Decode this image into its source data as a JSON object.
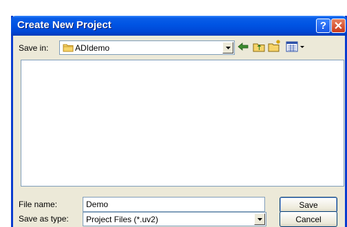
{
  "window": {
    "title": "Create New Project"
  },
  "titlebar": {
    "help_glyph": "?",
    "close_glyph": "✕"
  },
  "save_in": {
    "label": "Save in:",
    "value": "ADIdemo",
    "icon": "folder-icon"
  },
  "toolbar": [
    {
      "name": "back-arrow-icon"
    },
    {
      "name": "up-one-level-icon"
    },
    {
      "name": "create-new-folder-icon"
    },
    {
      "name": "view-menu-icon"
    }
  ],
  "file_list": {
    "items": []
  },
  "file_name": {
    "label": "File name:",
    "value": "Demo"
  },
  "save_as_type": {
    "label": "Save as type:",
    "value": "Project Files (*.uv2)"
  },
  "buttons": {
    "save": "Save",
    "cancel": "Cancel"
  },
  "colors": {
    "titlebar": "#0054e3",
    "dialog_bg": "#ece9d8",
    "field_border": "#7f9db9"
  }
}
